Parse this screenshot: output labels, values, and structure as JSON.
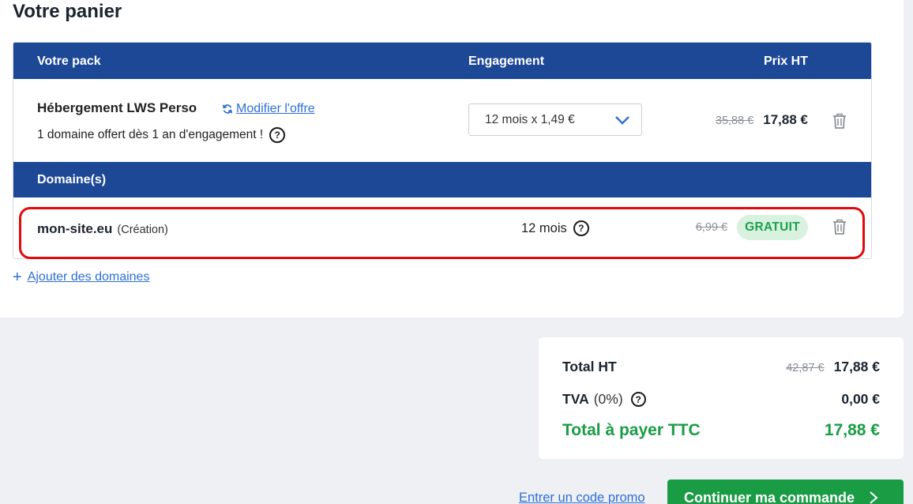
{
  "cart": {
    "title": "Votre panier",
    "headers": {
      "pack": "Votre pack",
      "engagement": "Engagement",
      "price": "Prix HT"
    },
    "pack": {
      "name": "Hébergement LWS Perso",
      "modify_link": "Modifier l'offre",
      "subtitle": "1 domaine offert dès 1 an d'engagement !",
      "engagement_selected": "12 mois x 1,49 €",
      "old_price": "35,88 €",
      "price": "17,88 €"
    },
    "domains_header": "Domaine(s)",
    "domain": {
      "name": "mon-site.eu",
      "kind": "(Création)",
      "period": "12 mois",
      "old_price": "6,99 €",
      "badge": "GRATUIT"
    },
    "add_domains": "Ajouter des domaines"
  },
  "summary": {
    "total_ht_label": "Total HT",
    "total_ht_old": "42,87 €",
    "total_ht": "17,88 €",
    "tva_label": "TVA",
    "tva_pct": "(0%)",
    "tva_value": "0,00 €",
    "total_ttc_label": "Total à payer TTC",
    "total_ttc": "17,88 €"
  },
  "actions": {
    "promo": "Entrer un code promo",
    "continue": "Continuer ma commande"
  },
  "colors": {
    "header_blue": "#1c4896",
    "link_blue": "#2d6fd6",
    "green": "#1a9c45",
    "highlight_red": "#e20a0a"
  },
  "icons": [
    "refresh-icon",
    "help-icon",
    "chevron-down-icon",
    "trash-icon",
    "plus-icon",
    "chevron-right-icon"
  ]
}
